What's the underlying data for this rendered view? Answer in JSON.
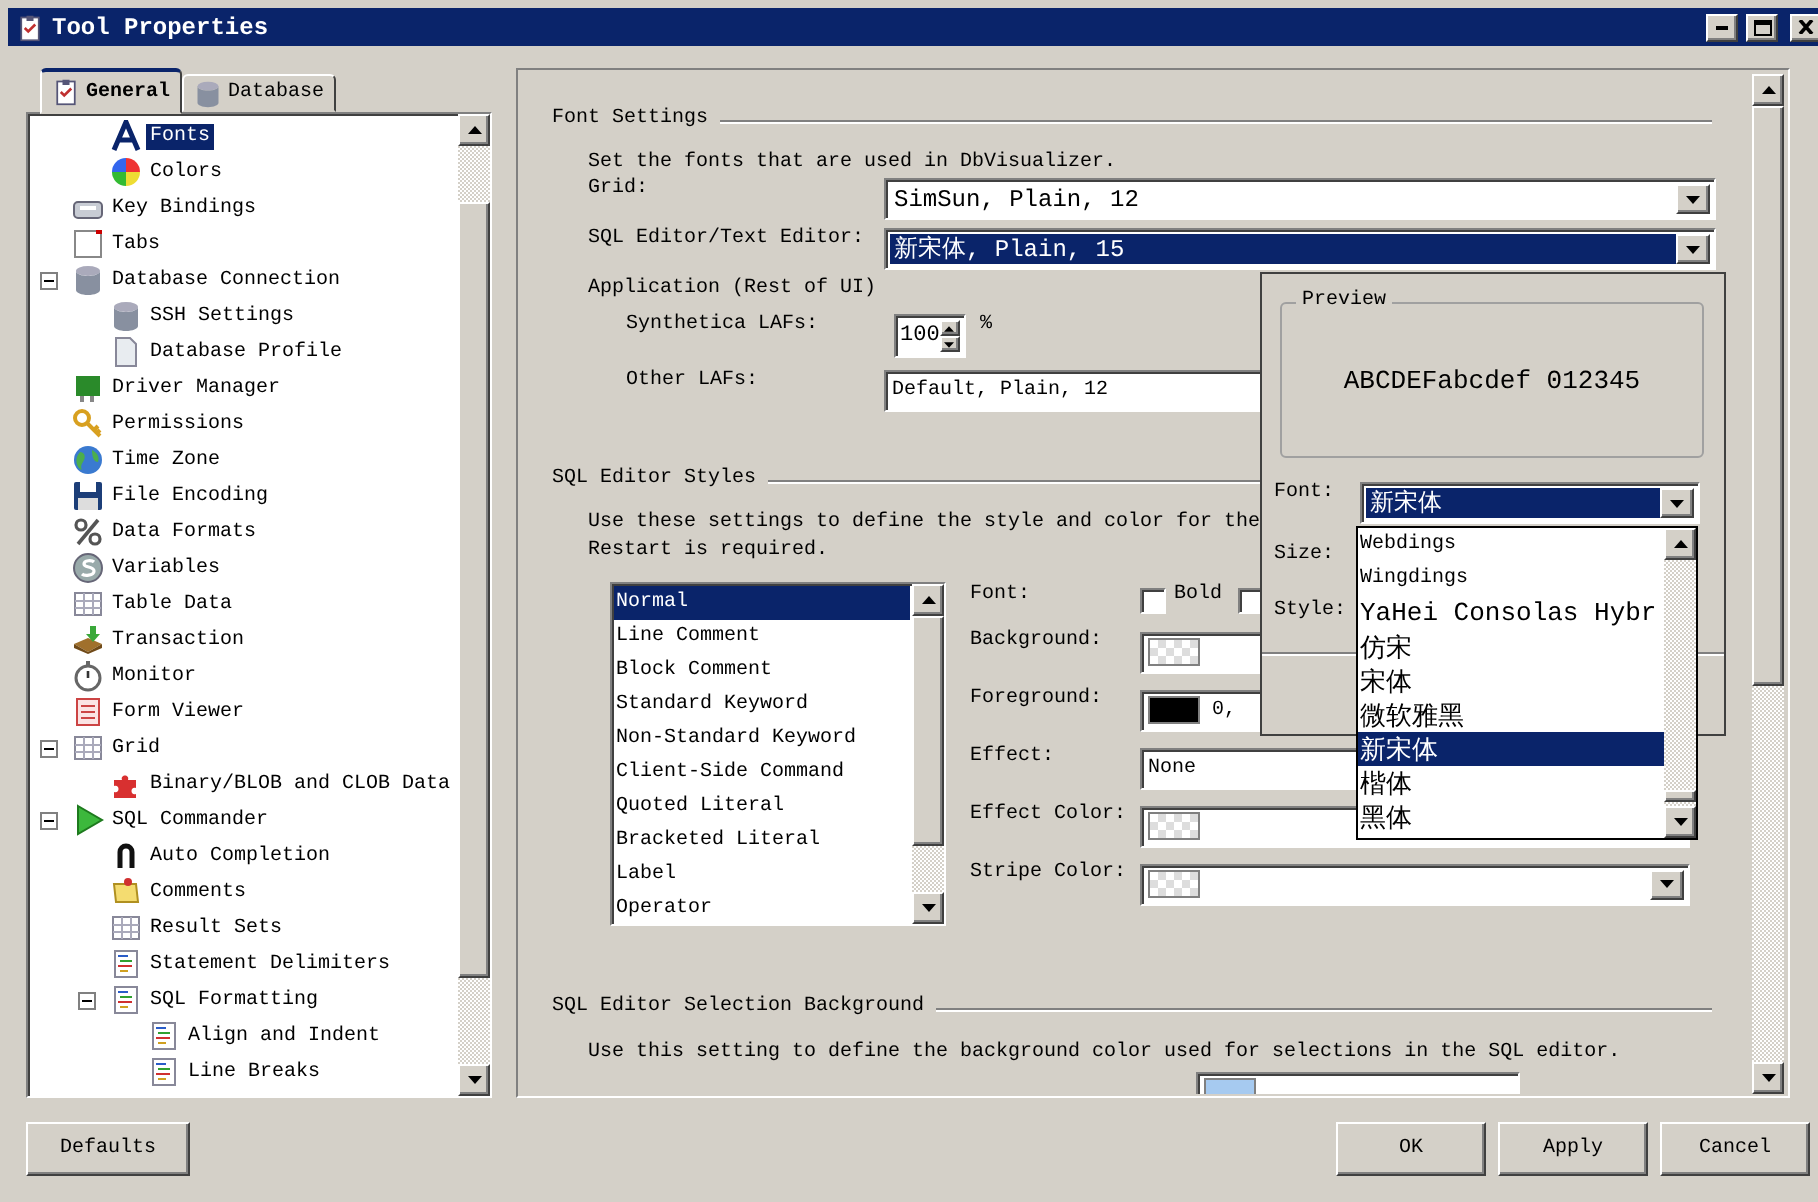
{
  "window": {
    "title": "Tool Properties"
  },
  "tabs": [
    {
      "label": "General",
      "selected": true
    },
    {
      "label": "Database",
      "selected": false
    }
  ],
  "tree": {
    "continued_children": [
      {
        "label": "Fonts",
        "selected": true
      },
      {
        "label": "Colors",
        "selected": false
      }
    ],
    "items": [
      {
        "label": "Key Bindings",
        "selected": false
      },
      {
        "label": "Tabs",
        "selected": false
      },
      {
        "label": "Database Connection",
        "selected": false,
        "expanded": true,
        "children": [
          {
            "label": "SSH Settings",
            "selected": false
          },
          {
            "label": "Database Profile",
            "selected": false
          }
        ]
      },
      {
        "label": "Driver Manager",
        "selected": false
      },
      {
        "label": "Permissions",
        "selected": false
      },
      {
        "label": "Time Zone",
        "selected": false
      },
      {
        "label": "File Encoding",
        "selected": false
      },
      {
        "label": "Data Formats",
        "selected": false
      },
      {
        "label": "Variables",
        "selected": false
      },
      {
        "label": "Table Data",
        "selected": false
      },
      {
        "label": "Transaction",
        "selected": false
      },
      {
        "label": "Monitor",
        "selected": false
      },
      {
        "label": "Form Viewer",
        "selected": false
      },
      {
        "label": "Grid",
        "selected": false,
        "expanded": true,
        "children": [
          {
            "label": "Binary/BLOB and CLOB Data",
            "selected": false
          }
        ]
      },
      {
        "label": "SQL Commander",
        "selected": false,
        "expanded": true,
        "children": [
          {
            "label": "Auto Completion",
            "selected": false
          },
          {
            "label": "Comments",
            "selected": false
          },
          {
            "label": "Result Sets",
            "selected": false
          },
          {
            "label": "Statement Delimiters",
            "selected": false
          },
          {
            "label": "SQL Formatting",
            "selected": false,
            "expanded": true,
            "children": [
              {
                "label": "Align and Indent",
                "selected": false
              },
              {
                "label": "Line Breaks",
                "selected": false
              }
            ]
          }
        ]
      }
    ]
  },
  "font_settings": {
    "title": "Font Settings",
    "description": "Set the fonts that are used in DbVisualizer.",
    "fields": [
      {
        "label": "Grid:",
        "value": "SimSun, Plain, 12",
        "selected": false
      },
      {
        "label": "SQL Editor/Text Editor:",
        "value": "新宋体, Plain, 15",
        "selected": true
      }
    ],
    "application": {
      "label": "Application (Rest of UI)",
      "synthetica": {
        "label": "Synthetica LAFs:",
        "value": "100",
        "unit": "%"
      },
      "other": {
        "label": "Other LAFs:",
        "value": "Default, Plain, 12"
      }
    }
  },
  "editor_styles": {
    "title": "SQL Editor Styles",
    "description": [
      "Use these settings to define the style and color for the",
      "Restart is required."
    ],
    "styles": [
      {
        "label": "Normal",
        "selected": true
      },
      {
        "label": "Line Comment",
        "selected": false
      },
      {
        "label": "Block Comment",
        "selected": false
      },
      {
        "label": "Standard Keyword",
        "selected": false
      },
      {
        "label": "Non-Standard Keyword",
        "selected": false
      },
      {
        "label": "Client-Side Command",
        "selected": false
      },
      {
        "label": "Quoted Literal",
        "selected": false
      },
      {
        "label": "Bracketed Literal",
        "selected": false
      },
      {
        "label": "Label",
        "selected": false
      },
      {
        "label": "Operator",
        "selected": false
      }
    ],
    "font": {
      "label": "Font:",
      "options": [
        {
          "label": "Bold",
          "checked": false
        },
        {
          "checked": false
        }
      ]
    },
    "background": {
      "label": "Background:"
    },
    "foreground": {
      "label": "Foreground:",
      "color": "#000000",
      "value": "0,"
    },
    "effect": {
      "label": "Effect:",
      "value": "None"
    },
    "effect_color": {
      "label": "Effect Color:"
    },
    "stripe_color": {
      "label": "Stripe Color:"
    }
  },
  "selection_background": {
    "title": "SQL Editor Selection Background",
    "description": "Use this setting to define the background color used for selections in the SQL editor.",
    "color": "#a6caf0"
  },
  "buttons": {
    "defaults": "Defaults",
    "actions": [
      "OK",
      "Apply",
      "Cancel"
    ]
  },
  "font_dialog": {
    "preview_title": "Preview",
    "preview_sample": "ABCDEFabcdef 012345",
    "font": {
      "label": "Font:",
      "value": "新宋体"
    },
    "size_label": "Size:",
    "style_label": "Style:",
    "font_list": [
      {
        "label": "Webdings",
        "selected": false
      },
      {
        "label": "Wingdings",
        "selected": false
      },
      {
        "label": "YaHei Consolas Hybr",
        "selected": false
      },
      {
        "label": "仿宋",
        "selected": false
      },
      {
        "label": "宋体",
        "selected": false
      },
      {
        "label": "微软雅黑",
        "selected": false
      },
      {
        "label": "新宋体",
        "selected": true
      },
      {
        "label": "楷体",
        "selected": false
      },
      {
        "label": "黑体",
        "selected": false
      }
    ]
  }
}
